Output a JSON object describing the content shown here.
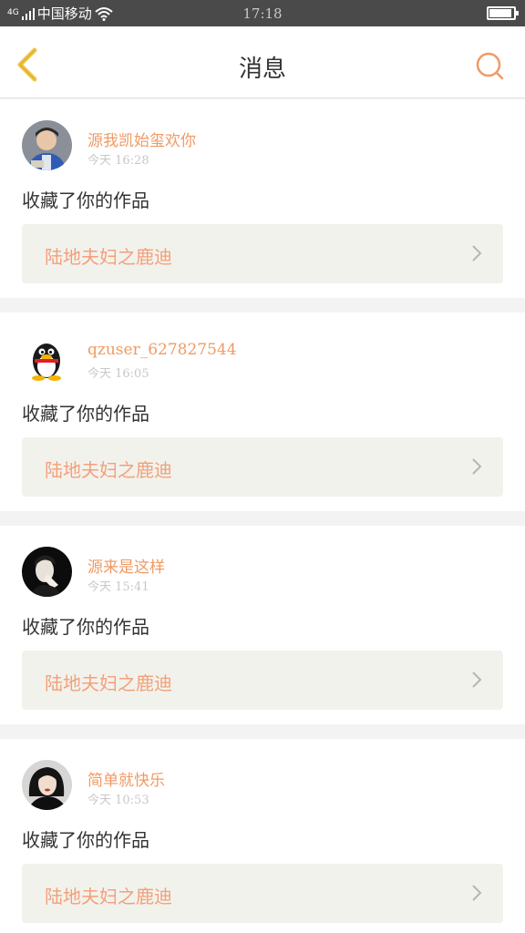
{
  "status_bar": {
    "network": "4G",
    "carrier": "中国移动",
    "time": "17:18"
  },
  "header": {
    "title": "消息"
  },
  "messages": [
    {
      "user": "源我凯始玺欢你",
      "time": "今天 16:28",
      "action": "收藏了你的作品",
      "work": "陆地夫妇之鹿迪"
    },
    {
      "user": "qzuser_627827544",
      "time": "今天 16:05",
      "action": "收藏了你的作品",
      "work": "陆地夫妇之鹿迪"
    },
    {
      "user": "源来是这样",
      "time": "今天 15:41",
      "action": "收藏了你的作品",
      "work": "陆地夫妇之鹿迪"
    },
    {
      "user": "简单就快乐",
      "time": "今天 10:53",
      "action": "收藏了你的作品",
      "work": "陆地夫妇之鹿迪"
    }
  ],
  "colors": {
    "accent": "#f09a64",
    "back_arrow": "#f5c542",
    "status_bar_bg": "#4a4a4a",
    "work_box_bg": "#f2f2ec"
  },
  "icons": [
    "signal-icon",
    "wifi-icon",
    "battery-icon",
    "back-arrow-icon",
    "search-icon",
    "chevron-right-icon"
  ]
}
